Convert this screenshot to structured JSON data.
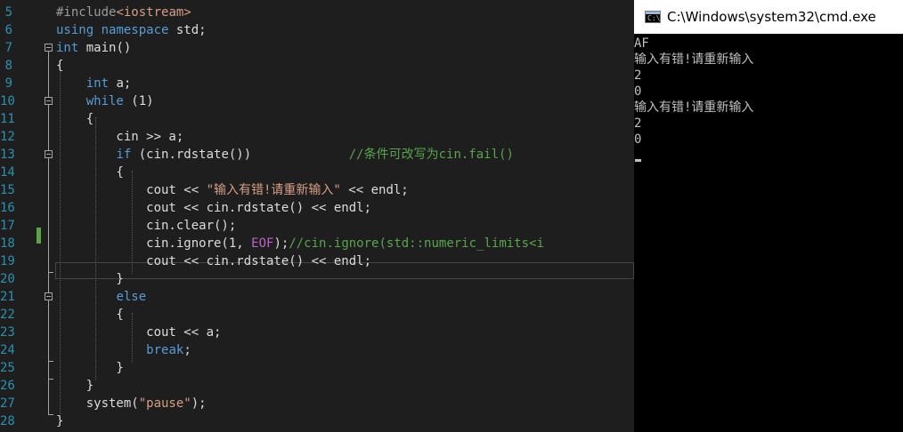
{
  "editor": {
    "lines": [
      {
        "num": "5",
        "parts": [
          [
            "pre",
            "#include"
          ],
          [
            "inc",
            "<iostream>"
          ]
        ]
      },
      {
        "num": "6",
        "parts": [
          [
            "kw",
            "using"
          ],
          [
            "",
            " "
          ],
          [
            "kw",
            "namespace"
          ],
          [
            "",
            " std;"
          ]
        ]
      },
      {
        "num": "7",
        "parts": [
          [
            "kw",
            "int"
          ],
          [
            "",
            " main()"
          ]
        ]
      },
      {
        "num": "8",
        "parts": [
          [
            "",
            "{"
          ]
        ]
      },
      {
        "num": "9",
        "parts": [
          [
            "",
            "    "
          ],
          [
            "kw",
            "int"
          ],
          [
            "",
            " a;"
          ]
        ]
      },
      {
        "num": "10",
        "parts": [
          [
            "",
            "    "
          ],
          [
            "kw",
            "while"
          ],
          [
            "",
            " (1)"
          ]
        ]
      },
      {
        "num": "11",
        "parts": [
          [
            "",
            "    {"
          ]
        ]
      },
      {
        "num": "12",
        "parts": [
          [
            "",
            "        cin >> a;"
          ]
        ]
      },
      {
        "num": "13",
        "parts": [
          [
            "",
            "        "
          ],
          [
            "kw",
            "if"
          ],
          [
            "",
            " (cin.rdstate())             "
          ],
          [
            "cm",
            "//条件可改写为cin.fail()"
          ]
        ]
      },
      {
        "num": "14",
        "parts": [
          [
            "",
            "        {"
          ]
        ]
      },
      {
        "num": "15",
        "parts": [
          [
            "",
            "            cout << "
          ],
          [
            "str",
            "\"输入有错!请重新输入\""
          ],
          [
            "",
            " << endl;"
          ]
        ]
      },
      {
        "num": "16",
        "parts": [
          [
            "",
            "            cout << cin.rdstate() << endl;"
          ]
        ]
      },
      {
        "num": "17",
        "parts": [
          [
            "",
            "            cin.clear();"
          ]
        ]
      },
      {
        "num": "18",
        "parts": [
          [
            "",
            "            cin.ignore(1, "
          ],
          [
            "mac",
            "EOF"
          ],
          [
            "",
            ");"
          ],
          [
            "cm",
            "//cin.ignore(std::numeric_limits<i"
          ]
        ]
      },
      {
        "num": "19",
        "parts": [
          [
            "",
            "            cout << cin.rdstate() << endl;"
          ]
        ]
      },
      {
        "num": "20",
        "parts": [
          [
            "",
            "        }"
          ]
        ]
      },
      {
        "num": "21",
        "parts": [
          [
            "",
            "        "
          ],
          [
            "kw",
            "else"
          ]
        ]
      },
      {
        "num": "22",
        "parts": [
          [
            "",
            "        {"
          ]
        ]
      },
      {
        "num": "23",
        "parts": [
          [
            "",
            "            cout << a;"
          ]
        ]
      },
      {
        "num": "24",
        "parts": [
          [
            "",
            "            "
          ],
          [
            "kw",
            "break"
          ],
          [
            "",
            ";"
          ]
        ]
      },
      {
        "num": "25",
        "parts": [
          [
            "",
            "        }"
          ]
        ]
      },
      {
        "num": "26",
        "parts": [
          [
            "",
            "    }"
          ]
        ]
      },
      {
        "num": "27",
        "parts": [
          [
            "",
            "    system("
          ],
          [
            "str",
            "\"pause\""
          ],
          [
            "",
            ");"
          ]
        ]
      },
      {
        "num": "28",
        "parts": [
          [
            "",
            "}"
          ]
        ]
      }
    ]
  },
  "console": {
    "title": "C:\\Windows\\system32\\cmd.exe",
    "icon": "cmd-window-icon",
    "icon_glyph": "C:\\",
    "output": [
      "AF",
      "输入有错!请重新输入",
      "2",
      "0",
      "输入有错!请重新输入",
      "2",
      "0"
    ]
  },
  "colors": {
    "editor_bg": "#1e1e1e",
    "keyword": "#569cd6",
    "string": "#d69d85",
    "comment": "#57a64a",
    "macro": "#bd63c5",
    "line_number": "#2b91af",
    "console_bg": "#000000"
  }
}
